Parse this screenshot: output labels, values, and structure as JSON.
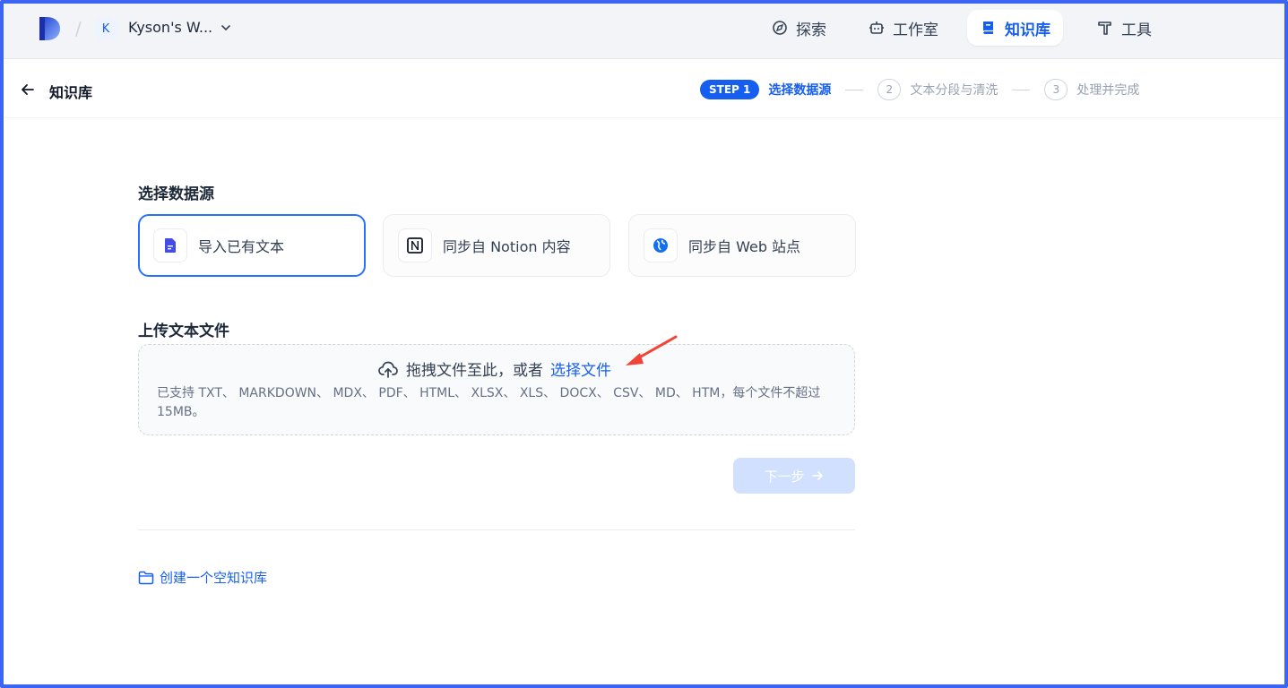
{
  "topbar": {
    "workspace_initial": "K",
    "workspace_name": "Kyson's W...",
    "nav": {
      "explore": "探索",
      "studio": "工作室",
      "knowledge": "知识库",
      "tools": "工具"
    }
  },
  "subheader": {
    "title": "知识库",
    "steps": {
      "step1_badge": "STEP 1",
      "step1_label": "选择数据源",
      "step2_num": "2",
      "step2_label": "文本分段与清洗",
      "step3_num": "3",
      "step3_label": "处理并完成"
    }
  },
  "main": {
    "datasource_title": "选择数据源",
    "sources": {
      "text": "导入已有文本",
      "notion": "同步自 Notion 内容",
      "web": "同步自 Web 站点"
    },
    "upload_title": "上传文本文件",
    "upload": {
      "drag_text": "拖拽文件至此，或者",
      "select_link": "选择文件",
      "hint": "已支持 TXT、 MARKDOWN、 MDX、 PDF、 HTML、 XLSX、 XLS、 DOCX、 CSV、 MD、 HTM，每个文件不超过 15MB。"
    },
    "next_label": "下一步",
    "create_empty": "创建一个空知识库"
  },
  "colors": {
    "accent": "#155eef",
    "frame": "#3b66f5",
    "annotation": "#f04438"
  }
}
